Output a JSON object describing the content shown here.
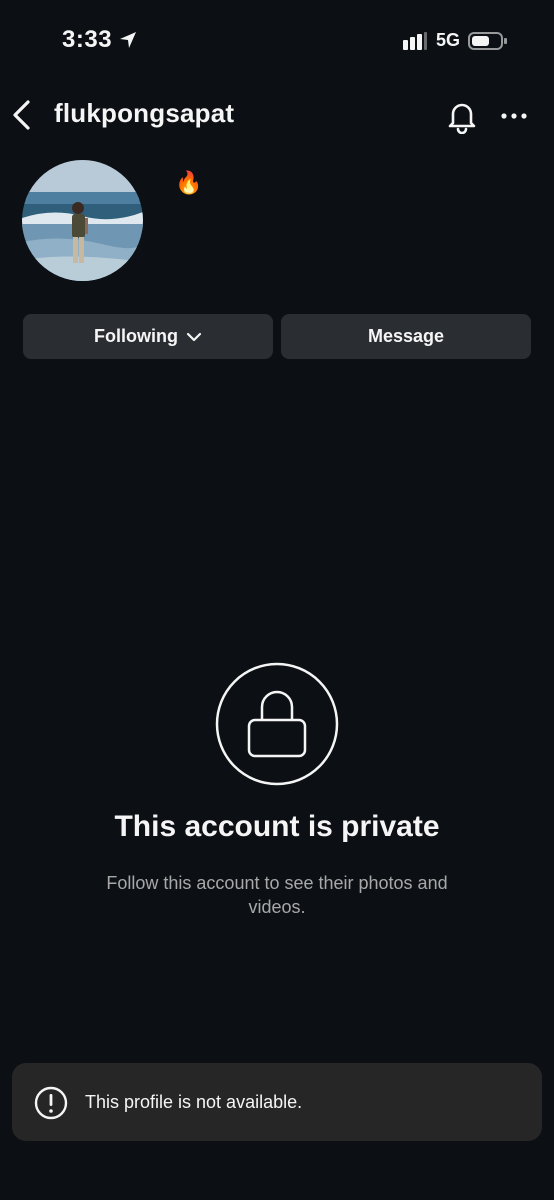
{
  "status_bar": {
    "time": "3:33",
    "network": "5G"
  },
  "header": {
    "username": "flukpongsapat"
  },
  "profile": {
    "bio": "🔥"
  },
  "actions": {
    "following_label": "Following",
    "message_label": "Message"
  },
  "private_notice": {
    "title": "This account is private",
    "subtitle": "Follow this account to see their photos and videos."
  },
  "toast": {
    "message": "This profile is not available."
  },
  "colors": {
    "background": "#0c1014",
    "button": "#2a2d32",
    "toast": "#262626",
    "secondary_text": "#a8a8a8"
  }
}
